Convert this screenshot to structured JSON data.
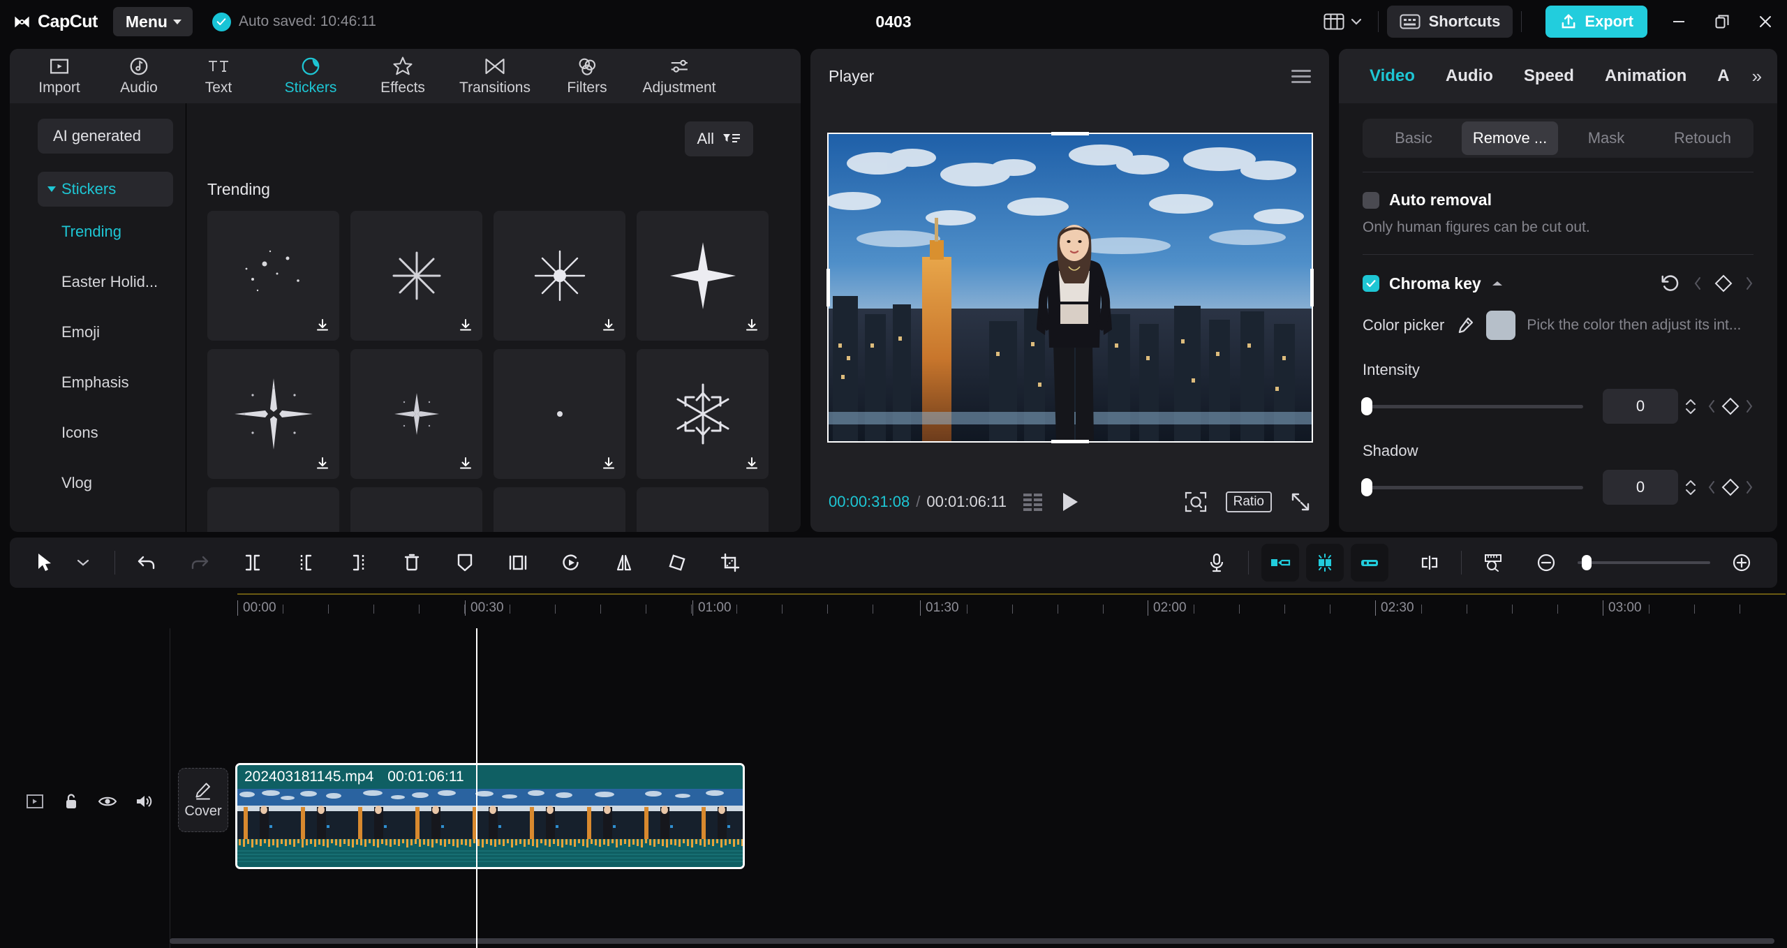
{
  "titlebar": {
    "app_name": "CapCut",
    "menu_label": "Menu",
    "autosave_text": "Auto saved: 10:46:11",
    "project_title": "0403",
    "shortcuts_label": "Shortcuts",
    "export_label": "Export",
    "accent_color": "#22cddd"
  },
  "toolbar": {
    "items": [
      {
        "label": "Import",
        "icon": "import-icon",
        "active": false
      },
      {
        "label": "Audio",
        "icon": "audio-icon",
        "active": false
      },
      {
        "label": "Text",
        "icon": "text-icon",
        "active": false
      },
      {
        "label": "Stickers",
        "icon": "stickers-icon",
        "active": true
      },
      {
        "label": "Effects",
        "icon": "effects-icon",
        "active": false
      },
      {
        "label": "Transitions",
        "icon": "transitions-icon",
        "active": false
      },
      {
        "label": "Filters",
        "icon": "filters-icon",
        "active": false
      },
      {
        "label": "Adjustment",
        "icon": "adjustment-icon",
        "active": false
      }
    ]
  },
  "library": {
    "ai_generated_label": "AI generated",
    "stickers_label": "Stickers",
    "categories": [
      {
        "label": "Trending",
        "selected": true
      },
      {
        "label": "Easter Holid...",
        "selected": false
      },
      {
        "label": "Emoji",
        "selected": false
      },
      {
        "label": "Emphasis",
        "selected": false
      },
      {
        "label": "Icons",
        "selected": false
      },
      {
        "label": "Vlog",
        "selected": false
      }
    ],
    "filter_label": "All",
    "section_title": "Trending",
    "sticker_count": 12
  },
  "player": {
    "title": "Player",
    "current_time": "00:00:31:08",
    "time_separator": "/",
    "total_time": "00:01:06:11",
    "ratio_label": "Ratio"
  },
  "inspector": {
    "tabs": [
      {
        "label": "Video",
        "active": true
      },
      {
        "label": "Audio",
        "active": false
      },
      {
        "label": "Speed",
        "active": false
      },
      {
        "label": "Animation",
        "active": false
      },
      {
        "label": "A",
        "active": false
      }
    ],
    "more_glyph": "»",
    "segments": [
      {
        "label": "Basic",
        "active": false
      },
      {
        "label": "Remove ...",
        "active": true
      },
      {
        "label": "Mask",
        "active": false
      },
      {
        "label": "Retouch",
        "active": false
      }
    ],
    "auto_removal": {
      "label": "Auto removal",
      "checked": false
    },
    "auto_removal_hint": "Only human figures can be cut out.",
    "chroma_key": {
      "label": "Chroma key",
      "checked": true
    },
    "color_picker": {
      "label": "Color picker",
      "hint": "Pick the color then adjust its int...",
      "swatch_color": "#b6bfc9"
    },
    "intensity": {
      "label": "Intensity",
      "value": "0",
      "percent": 0
    },
    "shadow": {
      "label": "Shadow",
      "value": "0",
      "percent": 0
    }
  },
  "timeline": {
    "ruler_labels": [
      "00:00",
      "00:30",
      "01:00",
      "01:30",
      "02:00",
      "02:30",
      "03:00"
    ],
    "cover_label": "Cover",
    "clip": {
      "name": "202403181145.mp4",
      "duration": "00:01:06:11"
    },
    "playhead_time": "00:00:31:08"
  }
}
